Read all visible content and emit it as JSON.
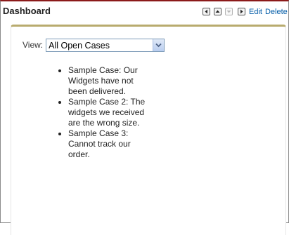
{
  "header": {
    "title": "Dashboard",
    "edit_label": "Edit",
    "delete_label": "Delete",
    "nav_icons": [
      "move-left-icon",
      "move-up-icon",
      "move-down-icon",
      "move-right-icon"
    ]
  },
  "view": {
    "label": "View:",
    "selected": "All Open Cases"
  },
  "cases": [
    "Sample Case: Our Widgets have not been delivered.",
    "Sample Case 2: The widgets we received are the wrong size.",
    "Sample Case 3: Cannot track our order."
  ],
  "colors": {
    "header_rule": "#8b1a1a",
    "panel_accent": "#b8ab6e",
    "link": "#015ba7"
  }
}
